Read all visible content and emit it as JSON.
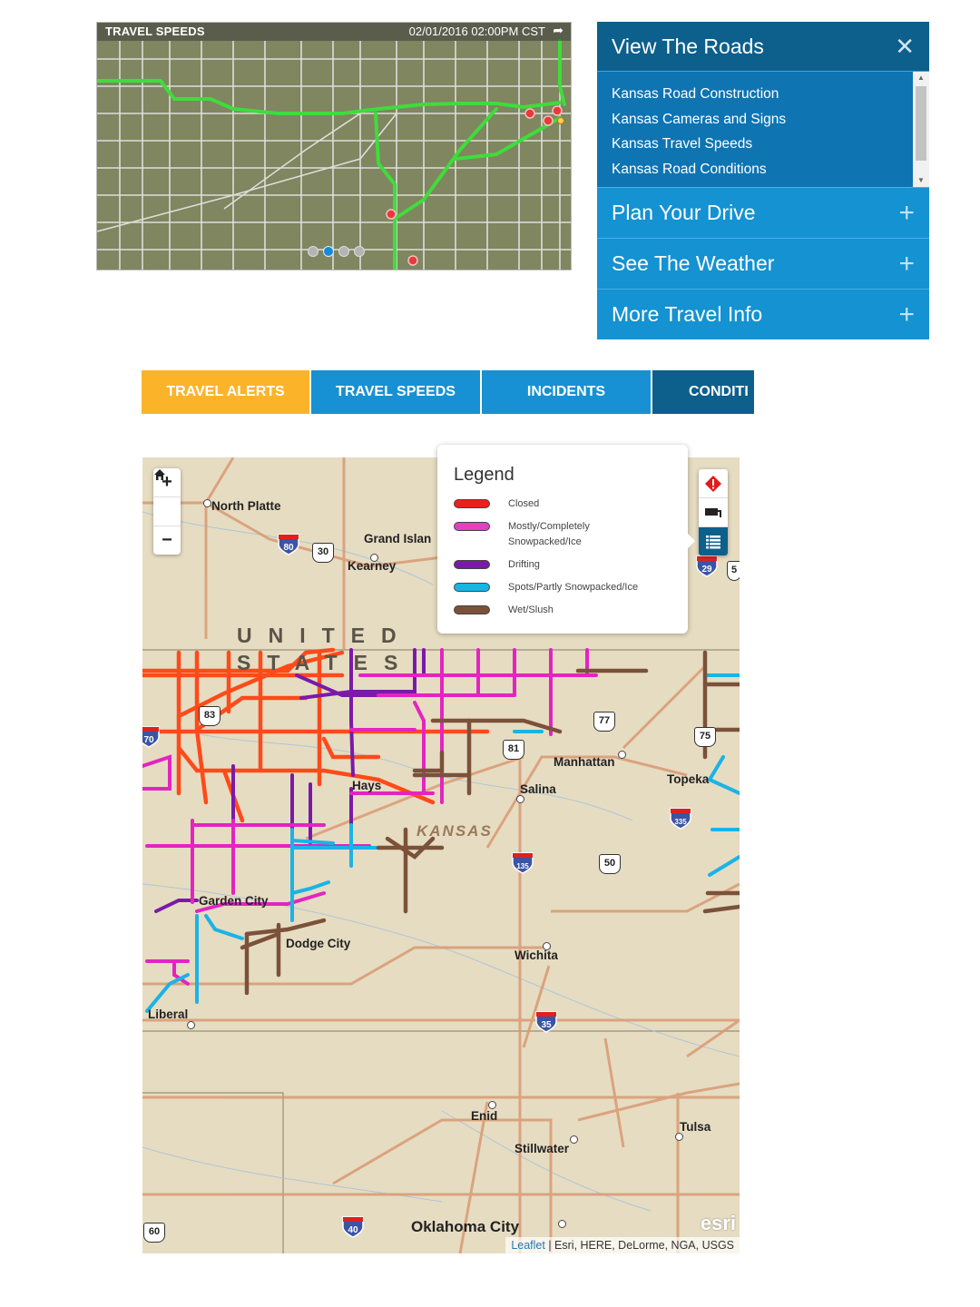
{
  "thumbnail": {
    "title": "TRAVEL SPEEDS",
    "timestamp": "02/01/2016 02:00PM CST",
    "share_icon": "share-arrow-icon",
    "pager": {
      "count": 4,
      "active_index": 1
    }
  },
  "accordion": {
    "open_section": {
      "title": "View The Roads",
      "close_icon": "close-icon",
      "links": [
        "Kansas Road Construction",
        "Kansas Cameras and Signs",
        "Kansas Travel Speeds",
        "Kansas Road Conditions"
      ]
    },
    "sections": [
      {
        "title": "Plan Your Drive",
        "icon": "plus-icon"
      },
      {
        "title": "See The Weather",
        "icon": "plus-icon"
      },
      {
        "title": "More Travel Info",
        "icon": "plus-icon"
      }
    ]
  },
  "tabs": [
    {
      "label": "TRAVEL ALERTS",
      "color": "#fbb42a"
    },
    {
      "label": "TRAVEL SPEEDS",
      "color": "#1791d3"
    },
    {
      "label": "INCIDENTS",
      "color": "#1791d3"
    },
    {
      "label": "CONDITI",
      "color": "#0d5f8c",
      "selected": true
    }
  ],
  "map": {
    "zoom_controls": {
      "zoom_in": "+",
      "home": "home-icon",
      "zoom_out": "−"
    },
    "tools": [
      "alert-diamond-icon",
      "truck-icon",
      "legend-list-icon"
    ],
    "legend": {
      "title": "Legend",
      "items": [
        {
          "label": "Closed",
          "color": "#e8211a"
        },
        {
          "label": "Mostly/Completely Snowpacked/Ice",
          "color": "#e83ec0"
        },
        {
          "label": "Drifting",
          "color": "#7a1aa8"
        },
        {
          "label": "Spots/Partly Snowpacked/Ice",
          "color": "#19b4e6"
        },
        {
          "label": "Wet/Slush",
          "color": "#7b513a"
        }
      ]
    },
    "country_label_1": "UNITED",
    "country_label_2": "STATES",
    "state_label": "KANSAS",
    "places": {
      "north_platte": "North Platte",
      "grand_island": "Grand Islan",
      "kearney": "Kearney",
      "hays": "Hays",
      "manhattan": "Manhattan",
      "topeka": "Topeka",
      "salina": "Salina",
      "garden_city": "Garden City",
      "dodge_city": "Dodge City",
      "wichita": "Wichita",
      "liberal": "Liberal",
      "enid": "Enid",
      "stillwater": "Stillwater",
      "tulsa": "Tulsa",
      "oklahoma_city": "Oklahoma City"
    },
    "shields": {
      "i80": "80",
      "us30": "30",
      "i29": "29",
      "us5": "5",
      "us83": "83",
      "i70": "70",
      "us77": "77",
      "us81": "81",
      "us75": "75",
      "i335": "335",
      "i135": "135",
      "us50": "50",
      "i35": "35",
      "i40": "40",
      "us60": "60"
    },
    "attribution": {
      "link": "Leaflet",
      "text": " | Esri, HERE, DeLorme, NGA, USGS"
    },
    "esri_logo": "esri"
  }
}
